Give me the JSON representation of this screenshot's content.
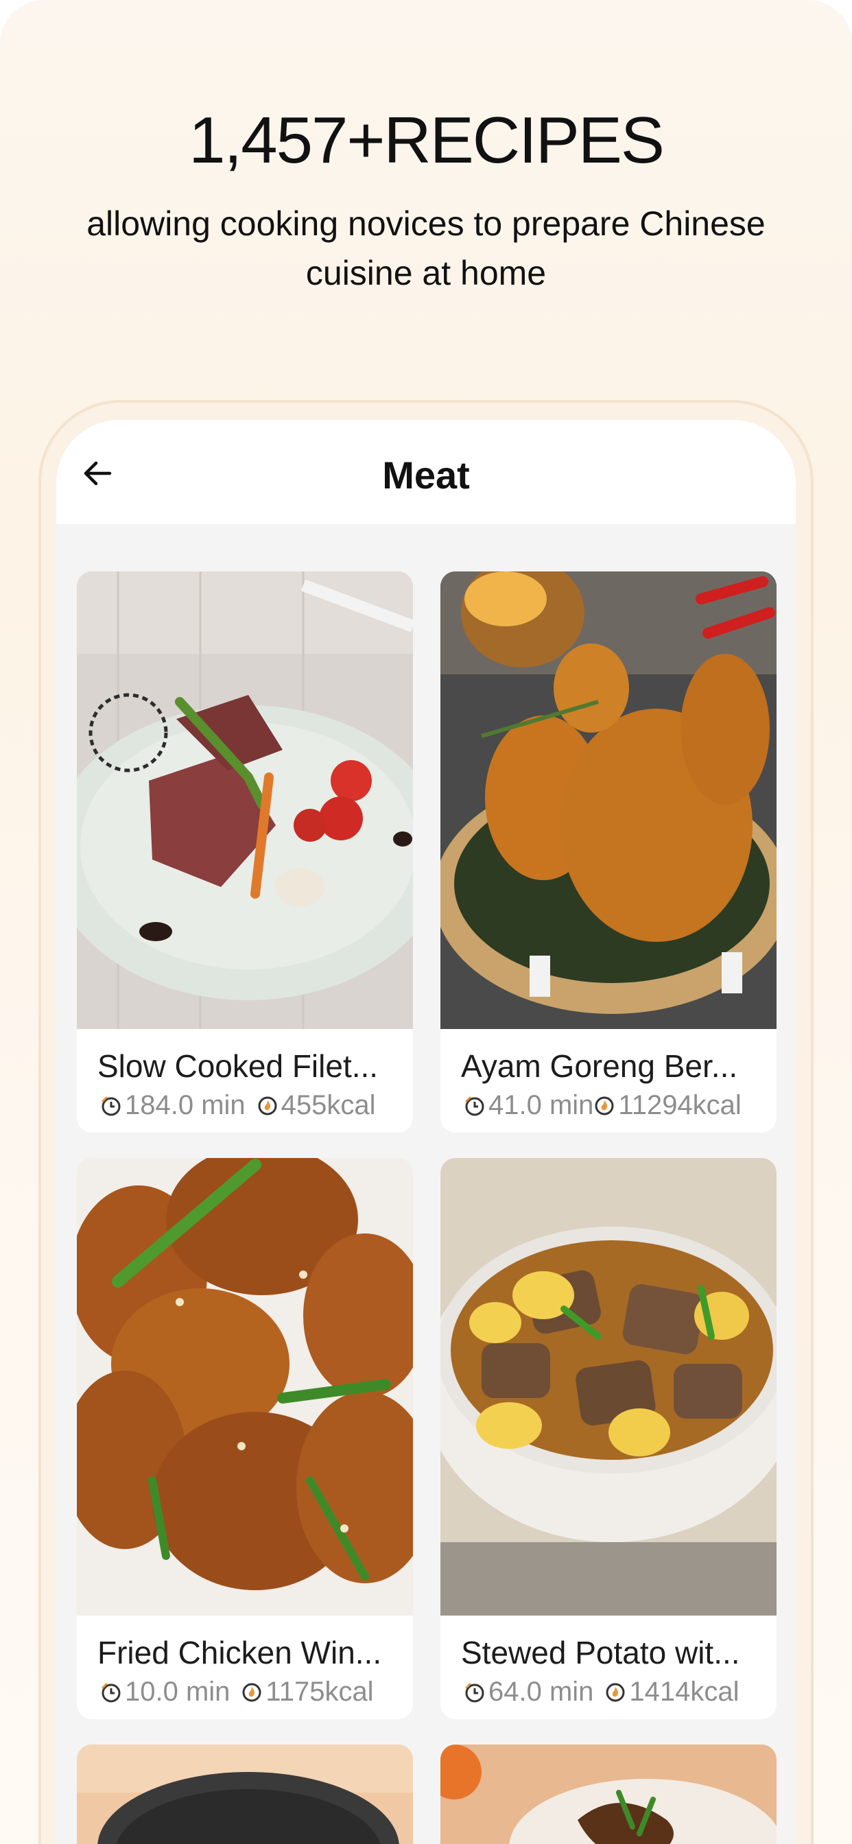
{
  "promo": {
    "headline": "1,457+RECIPES",
    "subline": "allowing cooking novices to prepare Chinese cuisine at home"
  },
  "nav": {
    "title": "Meat",
    "back_icon": "arrow-left-icon"
  },
  "recipes": [
    {
      "title": "Slow Cooked Filet...",
      "time": "184.0 min",
      "calories": "455kcal"
    },
    {
      "title": "Ayam Goreng Ber...",
      "time": "41.0 min",
      "calories": "11294kcal"
    },
    {
      "title": "Fried Chicken Win...",
      "time": "10.0 min",
      "calories": "1175kcal"
    },
    {
      "title": "Stewed Potato wit...",
      "time": "64.0 min",
      "calories": "1414kcal"
    }
  ],
  "icons": {
    "time": "clock-icon",
    "calories": "flame-icon"
  },
  "colors": {
    "accent": "#e8963a",
    "background": "#fcf6ee",
    "card": "#ffffff",
    "meta_text": "#8d8d8d"
  }
}
